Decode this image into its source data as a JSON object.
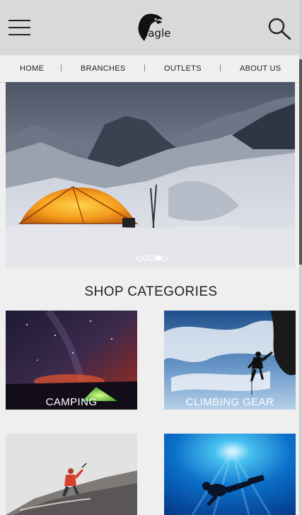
{
  "header": {
    "logo_text": "eagle",
    "logo_icon": "eagle-head-icon",
    "menu_icon": "hamburger-menu-icon",
    "search_icon": "search-icon"
  },
  "nav": {
    "items": [
      {
        "label": "HOME"
      },
      {
        "label": "BRANCHES"
      },
      {
        "label": "OUTLETS"
      },
      {
        "label": "ABOUT US"
      }
    ]
  },
  "hero": {
    "slide_count": 5,
    "active_slide": 4
  },
  "categories": {
    "title": "SHOP CATEGORIES",
    "items": [
      {
        "label": "CAMPING"
      },
      {
        "label": "CLIMBING  GEAR"
      },
      {
        "label": ""
      },
      {
        "label": ""
      }
    ]
  },
  "colors": {
    "header_bg": "#d9d9d9",
    "page_bg": "#efefef",
    "text": "#222222"
  }
}
